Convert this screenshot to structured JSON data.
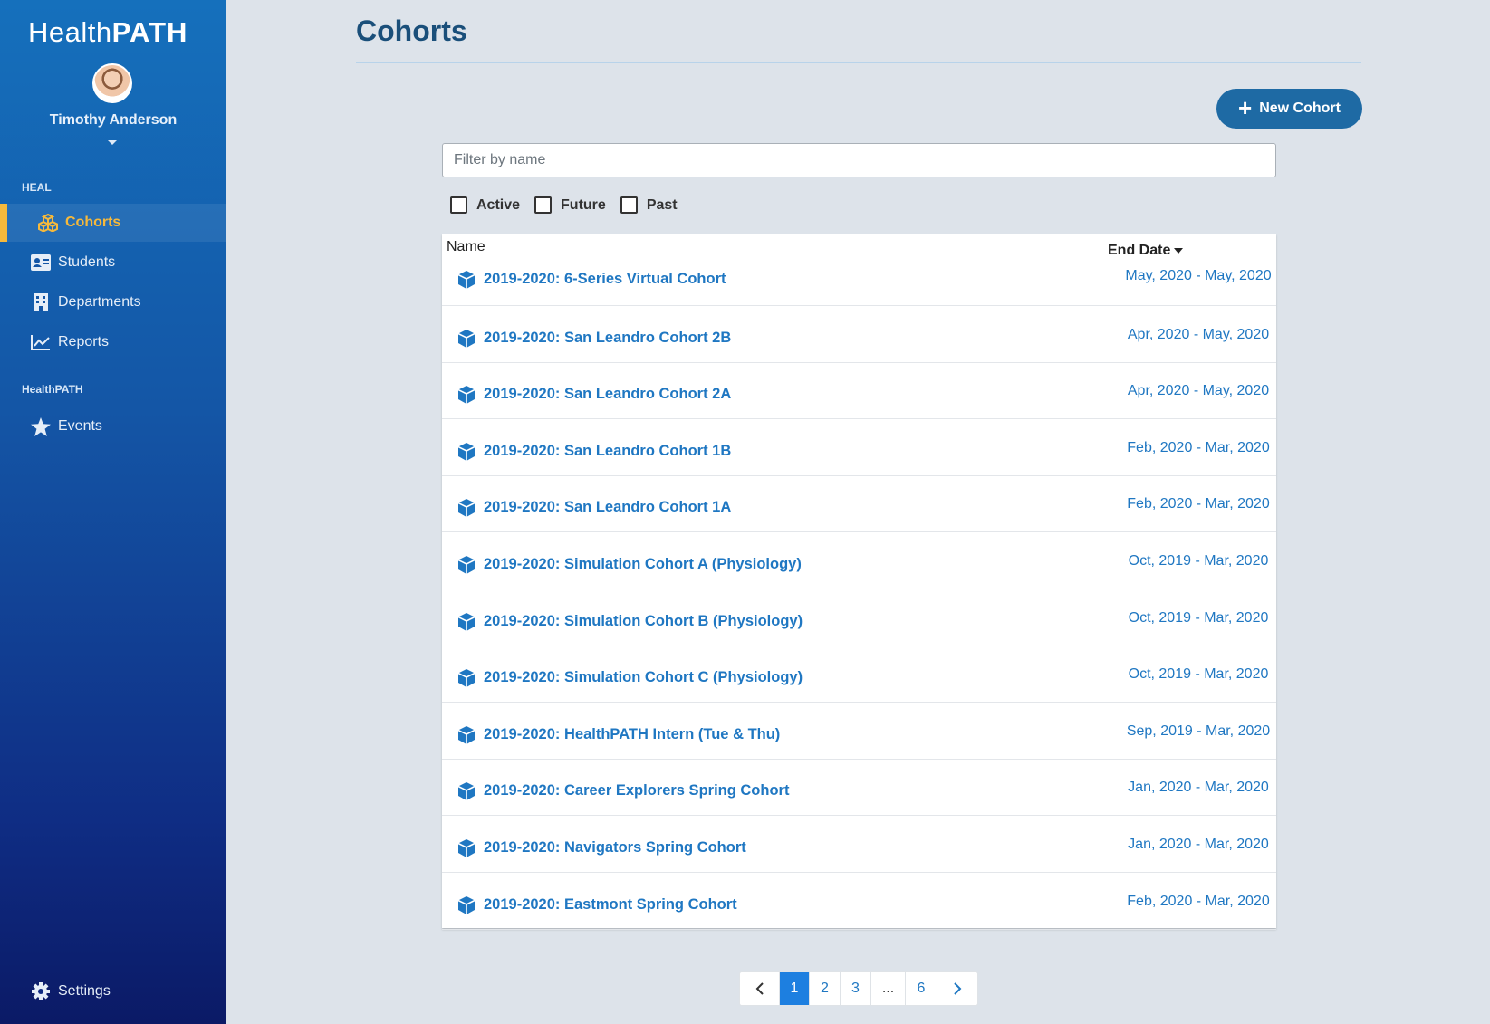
{
  "app": {
    "logo_light": "Health",
    "logo_bold": "PATH"
  },
  "user": {
    "name": "Timothy Anderson"
  },
  "sidebar": {
    "sections": [
      "HEAL",
      "HealthPATH"
    ],
    "items": [
      {
        "label": "Cohorts",
        "icon": "cubes-icon"
      },
      {
        "label": "Students",
        "icon": "id-card-icon"
      },
      {
        "label": "Departments",
        "icon": "building-icon"
      },
      {
        "label": "Reports",
        "icon": "chart-line-icon"
      },
      {
        "label": "Events",
        "icon": "star-icon"
      }
    ],
    "settings_label": "Settings"
  },
  "main": {
    "title": "Cohorts",
    "new_button": "New Cohort",
    "filter_placeholder": "Filter by name",
    "checkboxes": [
      "Active",
      "Future",
      "Past"
    ]
  },
  "table": {
    "col_name": "Name",
    "col_date": "End Date",
    "rows": [
      {
        "name": "2019-2020: 6-Series Virtual Cohort",
        "dates": "May, 2020 - May, 2020"
      },
      {
        "name": "2019-2020: San Leandro Cohort 2B",
        "dates": "Apr, 2020 - May, 2020"
      },
      {
        "name": "2019-2020: San Leandro Cohort 2A",
        "dates": "Apr, 2020 - May, 2020"
      },
      {
        "name": "2019-2020: San Leandro Cohort 1B",
        "dates": "Feb, 2020 - Mar, 2020"
      },
      {
        "name": "2019-2020: San Leandro Cohort 1A",
        "dates": "Feb, 2020 - Mar, 2020"
      },
      {
        "name": "2019-2020: Simulation Cohort A (Physiology)",
        "dates": "Oct, 2019 - Mar, 2020"
      },
      {
        "name": "2019-2020: Simulation Cohort B (Physiology)",
        "dates": "Oct, 2019 - Mar, 2020"
      },
      {
        "name": "2019-2020: Simulation Cohort C (Physiology)",
        "dates": "Oct, 2019 - Mar, 2020"
      },
      {
        "name": "2019-2020: HealthPATH Intern (Tue & Thu)",
        "dates": "Sep, 2019 - Mar, 2020"
      },
      {
        "name": "2019-2020: Career Explorers Spring Cohort",
        "dates": "Jan, 2020 - Mar, 2020"
      },
      {
        "name": "2019-2020: Navigators Spring Cohort",
        "dates": "Jan, 2020 - Mar, 2020"
      },
      {
        "name": "2019-2020: Eastmont Spring Cohort",
        "dates": "Feb, 2020 - Mar, 2020"
      }
    ]
  },
  "pagination": {
    "pages": [
      "1",
      "2",
      "3",
      "...",
      "6"
    ],
    "current": "1"
  },
  "colors": {
    "accent": "#1f77c2",
    "active_nav": "#f6b93b",
    "button": "#1e6aa4"
  }
}
